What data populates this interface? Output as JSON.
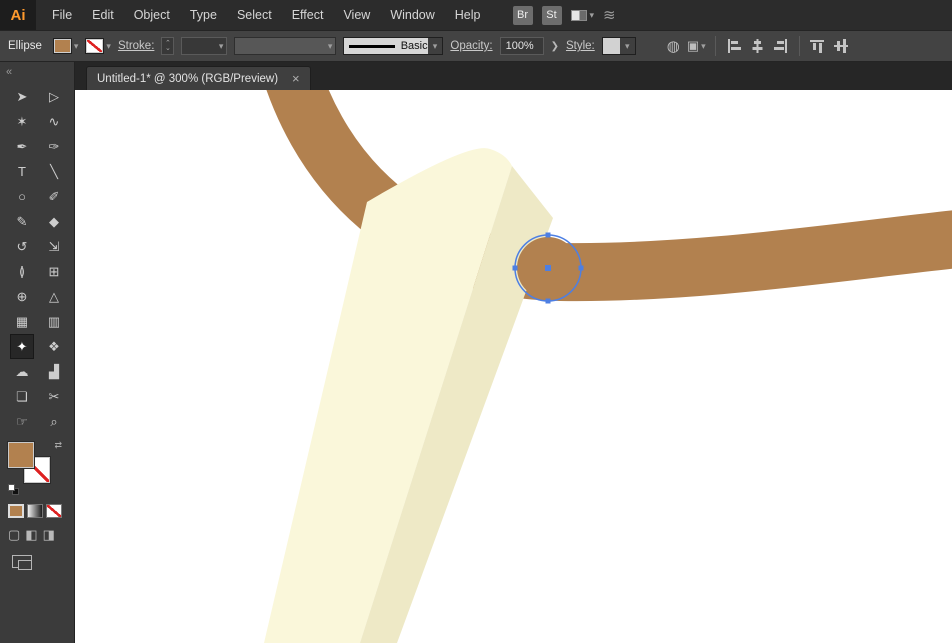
{
  "glyphs": {
    "chevron_down": "▾",
    "chevron_right": "❯",
    "chevron_tiny_up": "⌃",
    "chevron_tiny_down": "⌄",
    "close": "×",
    "collapse": "«",
    "swap": "⇄",
    "workspace_chevron": "▾",
    "gesture": "≋",
    "recolor": "◍",
    "isolate": "▣",
    "mode_normal": "▢",
    "mode_behind": "◧",
    "mode_inside": "◨"
  },
  "menubar": {
    "logo": "Ai",
    "items": [
      {
        "name": "menu-file",
        "label": "File"
      },
      {
        "name": "menu-edit",
        "label": "Edit"
      },
      {
        "name": "menu-object",
        "label": "Object"
      },
      {
        "name": "menu-type",
        "label": "Type"
      },
      {
        "name": "menu-select",
        "label": "Select"
      },
      {
        "name": "menu-effect",
        "label": "Effect"
      },
      {
        "name": "menu-view",
        "label": "View"
      },
      {
        "name": "menu-window",
        "label": "Window"
      },
      {
        "name": "menu-help",
        "label": "Help"
      }
    ],
    "badges": [
      {
        "name": "brushes-badge",
        "label": "Br"
      },
      {
        "name": "graphic-styles-badge",
        "label": "St"
      }
    ]
  },
  "controlbar": {
    "selection_type": "Ellipse",
    "stroke_label": "Stroke:",
    "brush_name": "Basic",
    "opacity_label": "Opacity:",
    "opacity_value": "100%",
    "style_label": "Style:"
  },
  "tab": {
    "title": "Untitled-1* @ 300% (RGB/Preview)"
  },
  "toolbar": {
    "tools": [
      {
        "name": "selection-tool",
        "glyph": "➤"
      },
      {
        "name": "direct-selection-tool",
        "glyph": "▷"
      },
      {
        "name": "magic-wand-tool",
        "glyph": "✶"
      },
      {
        "name": "lasso-tool",
        "glyph": "∿"
      },
      {
        "name": "pen-tool",
        "glyph": "✒"
      },
      {
        "name": "curvature-tool",
        "glyph": "✑"
      },
      {
        "name": "type-tool",
        "glyph": "T"
      },
      {
        "name": "line-segment-tool",
        "glyph": "╲"
      },
      {
        "name": "ellipse-tool",
        "glyph": "○"
      },
      {
        "name": "paintbrush-tool",
        "glyph": "✐"
      },
      {
        "name": "pencil-tool",
        "glyph": "✎"
      },
      {
        "name": "eraser-tool",
        "glyph": "◆"
      },
      {
        "name": "rotate-tool",
        "glyph": "↺"
      },
      {
        "name": "scale-tool",
        "glyph": "⇲"
      },
      {
        "name": "width-tool",
        "glyph": "≬"
      },
      {
        "name": "free-transform-tool",
        "glyph": "⊞"
      },
      {
        "name": "shape-builder-tool",
        "glyph": "⊕"
      },
      {
        "name": "perspective-grid-tool",
        "glyph": "△"
      },
      {
        "name": "mesh-tool",
        "glyph": "▦"
      },
      {
        "name": "gradient-tool",
        "glyph": "▥"
      },
      {
        "name": "eyedropper-tool",
        "glyph": "✦",
        "selected": true
      },
      {
        "name": "blend-tool",
        "glyph": "❖"
      },
      {
        "name": "symbol-sprayer-tool",
        "glyph": "☁"
      },
      {
        "name": "column-graph-tool",
        "glyph": "▟"
      },
      {
        "name": "artboard-tool",
        "glyph": "❏"
      },
      {
        "name": "slice-tool",
        "glyph": "✂"
      },
      {
        "name": "hand-tool",
        "glyph": "☞"
      },
      {
        "name": "zoom-tool",
        "glyph": "⌕"
      }
    ]
  },
  "colors": {
    "band": "#b2814f",
    "cream": "#faf7da",
    "cream_shade": "#eee9c6",
    "selection": "#4d7fe3",
    "fill_swatch": "#b2814f",
    "accent_orange": "#ff9a2e"
  }
}
